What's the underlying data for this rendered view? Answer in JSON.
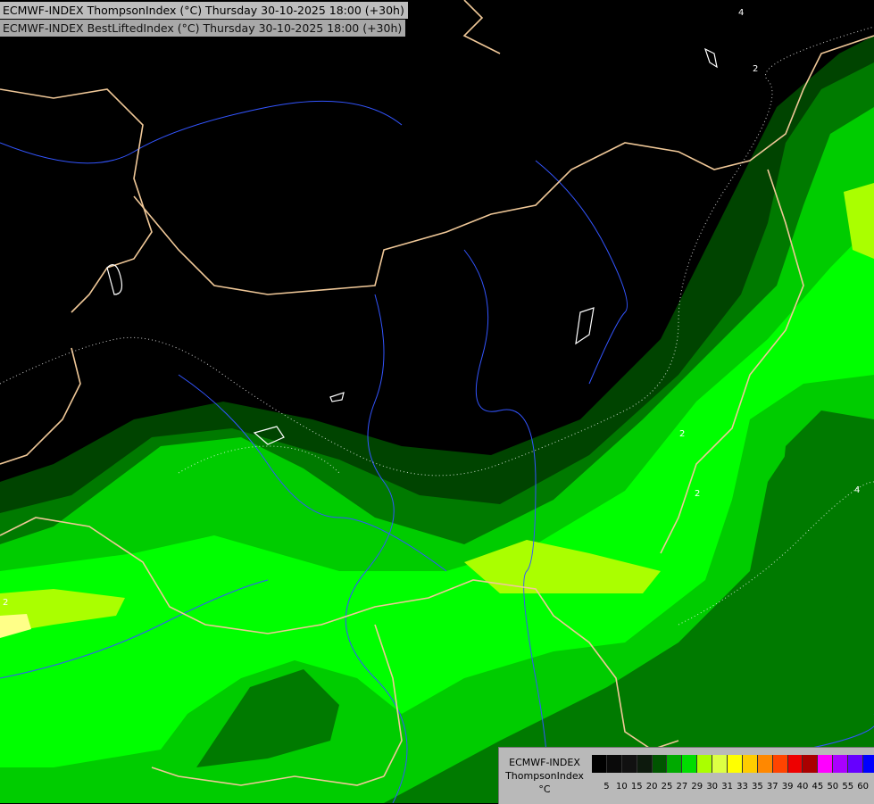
{
  "header": {
    "line1": "ECMWF-INDEX ThompsonIndex (°C) Thursday 30-10-2025 18:00 (+30h)",
    "line2": "ECMWF-INDEX BestLiftedIndex (°C) Thursday 30-10-2025 18:00 (+30h)"
  },
  "contour_labels": [
    "4",
    "2",
    "2",
    "2",
    "4",
    "2"
  ],
  "legend": {
    "line1": "ECMWF-INDEX",
    "line2": "ThompsonIndex",
    "line3": "°C",
    "ticks": [
      "5",
      "10",
      "15",
      "20",
      "25",
      "27",
      "29",
      "30",
      "31",
      "33",
      "35",
      "37",
      "39",
      "40",
      "45",
      "50",
      "55",
      "60"
    ],
    "colors": [
      "#000000",
      "#0a0a0a",
      "#111111",
      "#0d1a0d",
      "#005500",
      "#00aa00",
      "#00dd00",
      "#aaff00",
      "#ddff44",
      "#ffff00",
      "#ffcc00",
      "#ff8800",
      "#ff4400",
      "#ee0000",
      "#aa0000",
      "#ff00ff",
      "#aa00ff",
      "#6600ff",
      "#0000ff"
    ]
  },
  "map": {
    "background": "#000000",
    "zone_colors": [
      "#004400",
      "#007a00",
      "#00cc00",
      "#00ff00",
      "#aaff00",
      "#ffff88"
    ],
    "border_color": "#f0c898",
    "river_color": "#3355ff"
  }
}
